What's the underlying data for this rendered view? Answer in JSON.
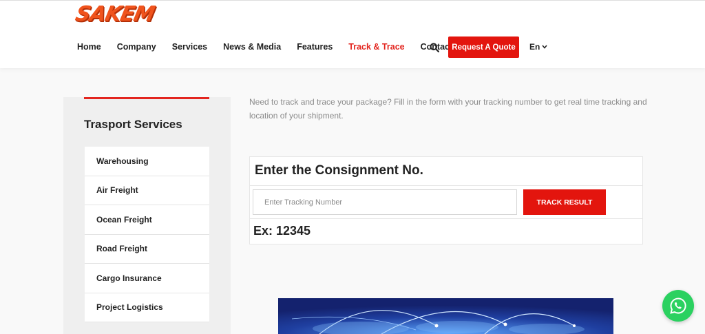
{
  "header": {
    "logo_text": "SAKEM",
    "nav": [
      {
        "label": "Home",
        "active": false
      },
      {
        "label": "Company",
        "active": false
      },
      {
        "label": "Services",
        "active": false
      },
      {
        "label": "News & Media",
        "active": false
      },
      {
        "label": "Features",
        "active": false
      },
      {
        "label": "Track & Trace",
        "active": true
      },
      {
        "label": "Contact",
        "active": false
      }
    ],
    "search_icon": "search-icon",
    "quote_button": "Request A Quote",
    "language": "En"
  },
  "sidebar": {
    "title": "Trasport Services",
    "items": [
      {
        "label": "Warehousing"
      },
      {
        "label": "Air Freight"
      },
      {
        "label": "Ocean Freight"
      },
      {
        "label": "Road Freight"
      },
      {
        "label": "Cargo Insurance"
      },
      {
        "label": "Project Logistics"
      }
    ]
  },
  "main": {
    "intro": "Need to track and trace your package? Fill in the form with your tracking number  to get real time tracking and location of your shipment.",
    "track": {
      "title": "Enter the Consignment No.",
      "input_placeholder": "Enter Tracking Number",
      "input_value": "",
      "button_label": "TRACK RESULT",
      "example": "Ex: 12345"
    }
  },
  "colors": {
    "accent": "#e3150e",
    "active_nav": "#e3261f",
    "whatsapp": "#2bd160",
    "logo": "#f0531c"
  },
  "floating": {
    "whatsapp_icon": "whatsapp-icon"
  }
}
